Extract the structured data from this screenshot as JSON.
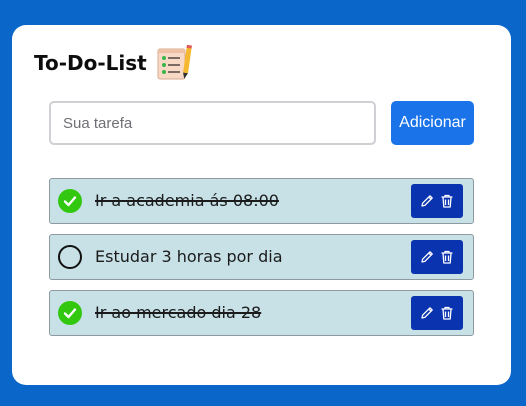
{
  "app": {
    "title": "To-Do-List",
    "title_icon": "checklist-with-pencil-icon"
  },
  "input": {
    "placeholder": "Sua tarefa",
    "value": ""
  },
  "add_button": {
    "label": "Adicionar"
  },
  "tasks": [
    {
      "text": "Ir a academia ás 08:00",
      "completed": true
    },
    {
      "text": "Estudar 3 horas por dia",
      "completed": false
    },
    {
      "text": "Ir ao mercado dia 28",
      "completed": true
    }
  ],
  "icons": {
    "status_done": "check-circle-icon",
    "status_todo": "empty-circle-icon",
    "edit": "pencil-icon",
    "delete": "trash-icon"
  },
  "colors": {
    "background": "#0a66c9",
    "card": "#ffffff",
    "add_button": "#1a73e8",
    "task_background": "#c7e1e6",
    "action_buttons": "#0a33b0",
    "done_check": "#31c80f"
  }
}
